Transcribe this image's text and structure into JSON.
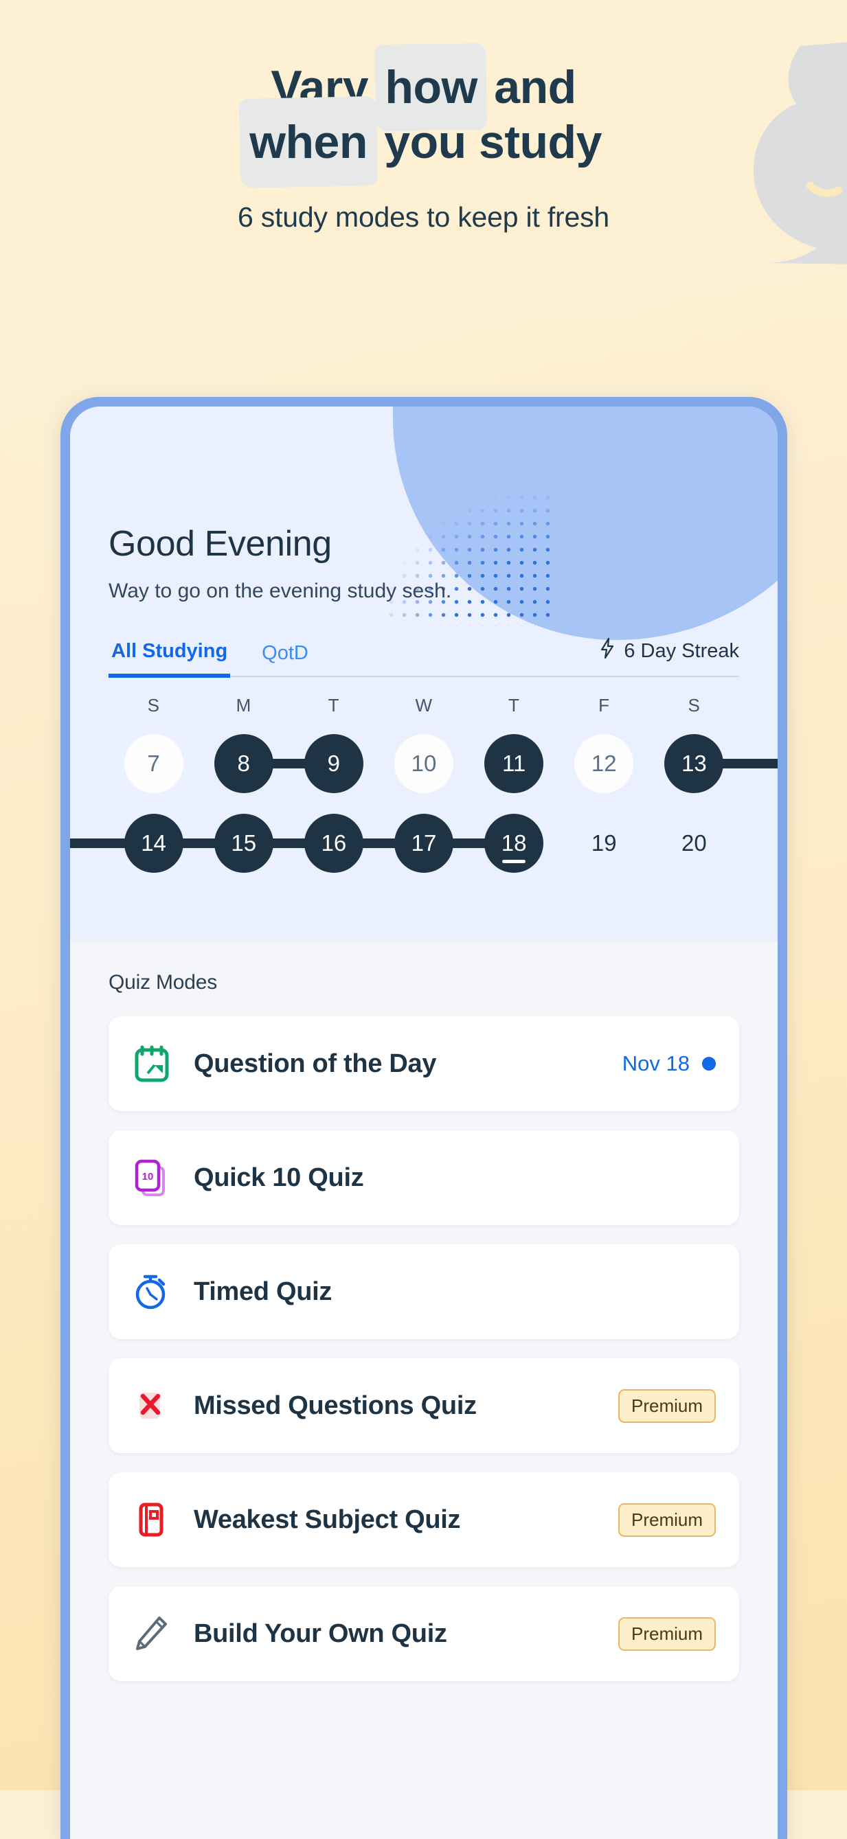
{
  "hero": {
    "line1_pre": "Vary ",
    "line1_hl": "how",
    "line1_post": " and",
    "line2_hl": "when",
    "line2_post": " you study",
    "subtitle": "6 study modes to keep it fresh"
  },
  "colors": {
    "background_top": "#FDF0D5",
    "background_bottom": "#FBE2AE",
    "phone_frame": "#7FA6E8",
    "app_hero_bg": "#EAF0FD",
    "accent_blue": "#1268E8",
    "dark_navy": "#1E3445",
    "premium_bg": "#FDEFC9",
    "premium_border": "#E8B861",
    "moon_gray": "#DCDDDE"
  },
  "app": {
    "greeting": "Good Evening",
    "greeting_sub": "Way to go on the evening study sesh.",
    "tabs": [
      {
        "label": "All Studying",
        "active": true
      },
      {
        "label": "QotD",
        "active": false
      }
    ],
    "streak": {
      "icon": "lightning-bolt-icon",
      "label": "6 Day Streak"
    },
    "calendar": {
      "weekday_headers": [
        "S",
        "M",
        "T",
        "W",
        "T",
        "F",
        "S"
      ],
      "week1": [
        {
          "num": "7",
          "state": "empty"
        },
        {
          "num": "8",
          "state": "filled",
          "connect": "right"
        },
        {
          "num": "9",
          "state": "filled",
          "connect": "left"
        },
        {
          "num": "10",
          "state": "empty"
        },
        {
          "num": "11",
          "state": "filled"
        },
        {
          "num": "12",
          "state": "empty"
        },
        {
          "num": "13",
          "state": "filled",
          "connect": "bleed-right"
        }
      ],
      "week2": [
        {
          "num": "14",
          "state": "filled",
          "connect": "both-bleed-left"
        },
        {
          "num": "15",
          "state": "filled",
          "connect": "both"
        },
        {
          "num": "16",
          "state": "filled",
          "connect": "both"
        },
        {
          "num": "17",
          "state": "filled",
          "connect": "both"
        },
        {
          "num": "18",
          "state": "filled",
          "connect": "left",
          "today": true
        },
        {
          "num": "19",
          "state": "plain"
        },
        {
          "num": "20",
          "state": "plain"
        }
      ]
    },
    "modes_title": "Quiz Modes",
    "modes": [
      {
        "label": "Question of the Day",
        "icon": "calendar-icon",
        "icon_color": "#0EA66B",
        "date": "Nov 18",
        "has_dot": true,
        "premium": false
      },
      {
        "label": "Quick 10 Quiz",
        "icon": "stacked-cards-10-icon",
        "icon_color": "#B220D8",
        "premium": false
      },
      {
        "label": "Timed Quiz",
        "icon": "stopwatch-icon",
        "icon_color": "#1268E8",
        "premium": false
      },
      {
        "label": "Missed Questions Quiz",
        "icon": "red-x-icon",
        "icon_color": "#E8192C",
        "premium": true,
        "premium_label": "Premium"
      },
      {
        "label": "Weakest Subject Quiz",
        "icon": "red-book-icon",
        "icon_color": "#EB1C24",
        "premium": true,
        "premium_label": "Premium"
      },
      {
        "label": "Build Your Own Quiz",
        "icon": "pencil-icon",
        "icon_color": "#5C6B7A",
        "premium": true,
        "premium_label": "Premium"
      }
    ]
  }
}
